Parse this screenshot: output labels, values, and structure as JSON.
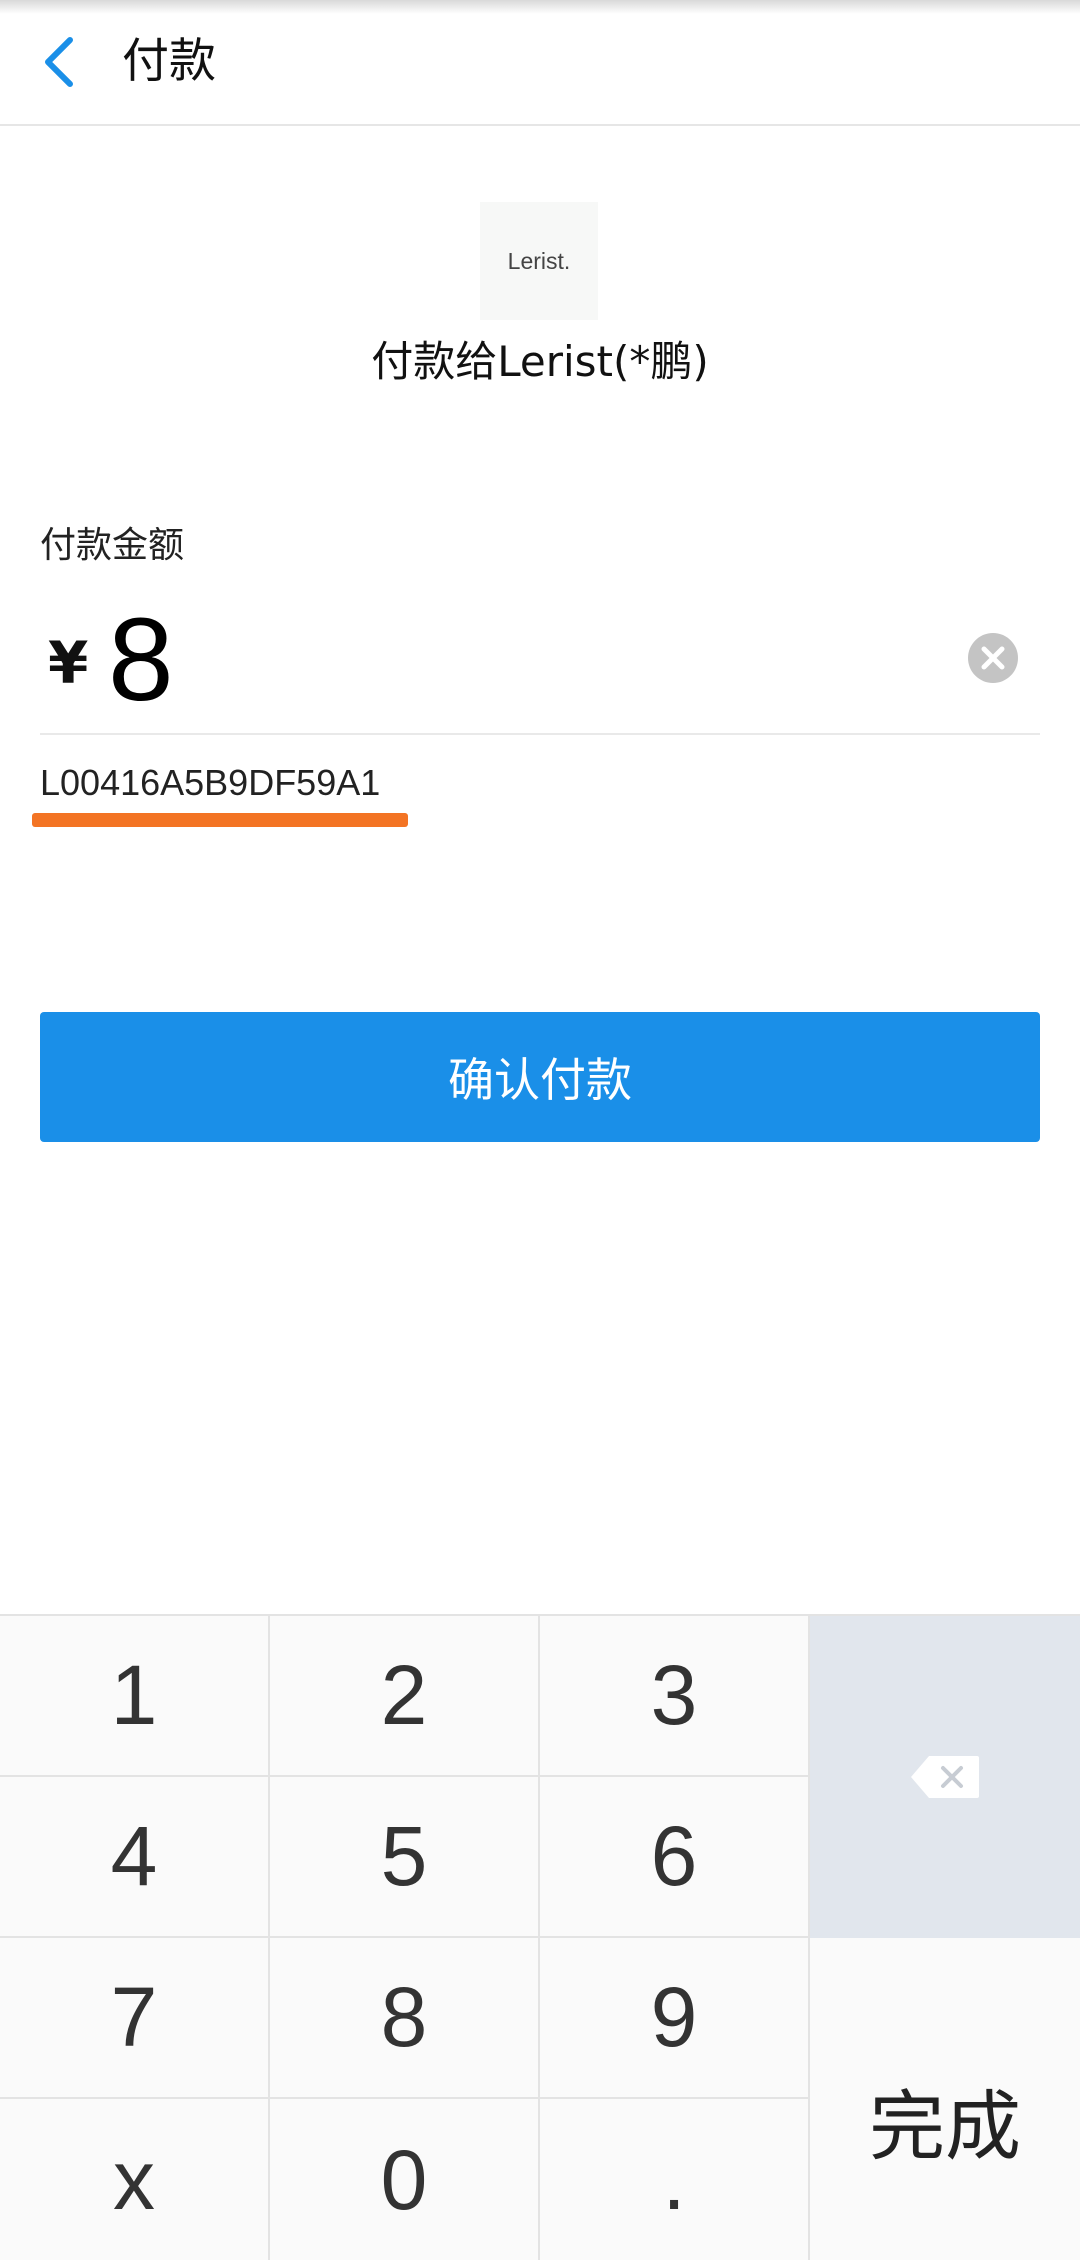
{
  "header": {
    "title": "付款",
    "back_icon": "chevron-left-icon"
  },
  "payee": {
    "logo_text": "Lerist.",
    "name": "付款给Lerist(*鹏)"
  },
  "amount": {
    "label": "付款金额",
    "currency": "¥",
    "value": "8",
    "clear_icon": "clear-circle-icon"
  },
  "remark": {
    "text": "L00416A5B9DF59A1",
    "highlight_color": "#f37424"
  },
  "confirm_button": {
    "label": "确认付款",
    "color": "#1a8fe8"
  },
  "keypad": {
    "keys": [
      "1",
      "2",
      "3",
      "4",
      "5",
      "6",
      "7",
      "8",
      "9",
      "x",
      "0",
      "."
    ],
    "backspace_icon": "backspace-icon",
    "done_label": "完成"
  }
}
